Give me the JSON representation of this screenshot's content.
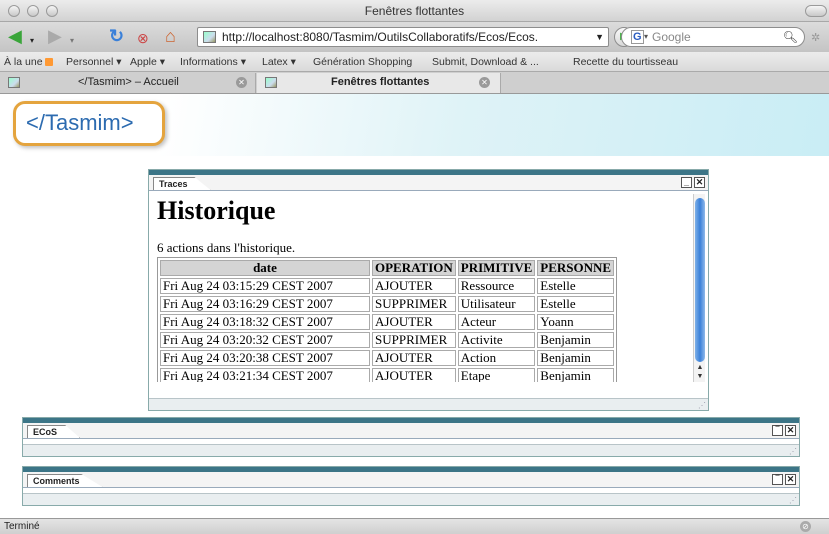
{
  "window": {
    "title": "Fenêtres flottantes"
  },
  "toolbar": {
    "url": "http://localhost:8080/Tasmim/OutilsCollaboratifs/Ecos/Ecos.",
    "search_placeholder": "Google",
    "search_engine_letter": "G"
  },
  "bookmarks": [
    {
      "label": "À la une"
    },
    {
      "label": "Personnel ▾"
    },
    {
      "label": "Apple ▾"
    },
    {
      "label": "Informations ▾"
    },
    {
      "label": "Latex ▾"
    },
    {
      "label": "Génération Shopping"
    },
    {
      "label": "Submit, Download & ..."
    },
    {
      "label": "Recette du tourtisseau"
    }
  ],
  "tabs": [
    {
      "label": "</Tasmim> – Accueil"
    },
    {
      "label": "Fenêtres flottantes"
    }
  ],
  "page": {
    "logo": "</Tasmim>",
    "traces_window": {
      "tab": "Traces",
      "heading": "Historique",
      "count_text": "6 actions dans l'historique.",
      "columns": [
        "date",
        "OPERATION",
        "PRIMITIVE",
        "PERSONNE"
      ],
      "rows": [
        [
          "Fri Aug 24 03:15:29 CEST 2007",
          "AJOUTER",
          "Ressource",
          "Estelle"
        ],
        [
          "Fri Aug 24 03:16:29 CEST 2007",
          "SUPPRIMER",
          "Utilisateur",
          "Estelle"
        ],
        [
          "Fri Aug 24 03:18:32 CEST 2007",
          "AJOUTER",
          "Acteur",
          "Yoann"
        ],
        [
          "Fri Aug 24 03:20:32 CEST 2007",
          "SUPPRIMER",
          "Activite",
          "Benjamin"
        ],
        [
          "Fri Aug 24 03:20:38 CEST 2007",
          "AJOUTER",
          "Action",
          "Benjamin"
        ],
        [
          "Fri Aug 24 03:21:34 CEST 2007",
          "AJOUTER",
          "Etape",
          "Benjamin"
        ]
      ]
    },
    "ecos_window": {
      "tab": "ECoS"
    },
    "comments_window": {
      "tab": "Comments"
    }
  },
  "status": {
    "text": "Terminé"
  },
  "colors": {
    "window_bar": "#3c7587",
    "logo_border": "#e4a43e",
    "logo_text": "#2c6bb0",
    "scroll_thumb": "#3a80d9"
  }
}
